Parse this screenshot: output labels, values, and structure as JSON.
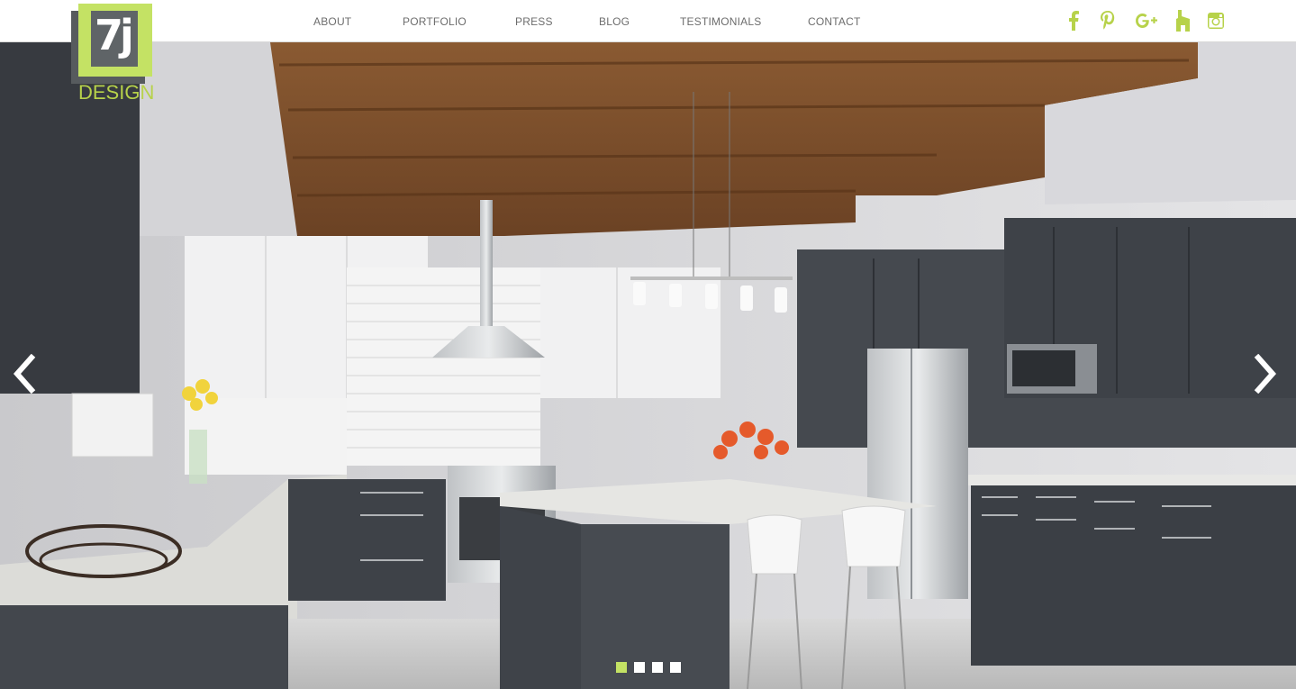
{
  "brand": {
    "logo_mark": "7j",
    "logo_word": "DESIGN",
    "accent": "#c4e264",
    "dark": "#5f6467"
  },
  "nav": {
    "items": [
      {
        "label": "ABOUT"
      },
      {
        "label": "PORTFOLIO"
      },
      {
        "label": "PRESS"
      },
      {
        "label": "BLOG"
      },
      {
        "label": "TESTIMONIALS"
      },
      {
        "label": "CONTACT"
      }
    ]
  },
  "social": {
    "color": "#b7d24a",
    "icons": [
      "facebook-icon",
      "pinterest-icon",
      "google-plus-icon",
      "houzz-icon",
      "instagram-icon"
    ]
  },
  "slider": {
    "prev_icon": "chevron-left-icon",
    "next_icon": "chevron-right-icon",
    "slide_count": 4,
    "active_index": 0
  }
}
